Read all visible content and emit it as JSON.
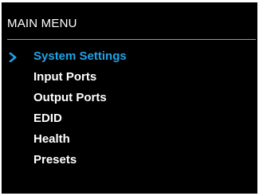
{
  "menu": {
    "title": "MAIN MENU",
    "items": [
      {
        "label": "System Settings",
        "selected": true
      },
      {
        "label": "Input Ports",
        "selected": false
      },
      {
        "label": "Output Ports",
        "selected": false
      },
      {
        "label": "EDID",
        "selected": false
      },
      {
        "label": "Health",
        "selected": false
      },
      {
        "label": "Presets",
        "selected": false
      }
    ],
    "selected_icon": "chevron-right-icon"
  },
  "colors": {
    "background": "#000000",
    "text": "#ffffff",
    "accent": "#1fa3e8",
    "divider": "#9a9a9a"
  }
}
